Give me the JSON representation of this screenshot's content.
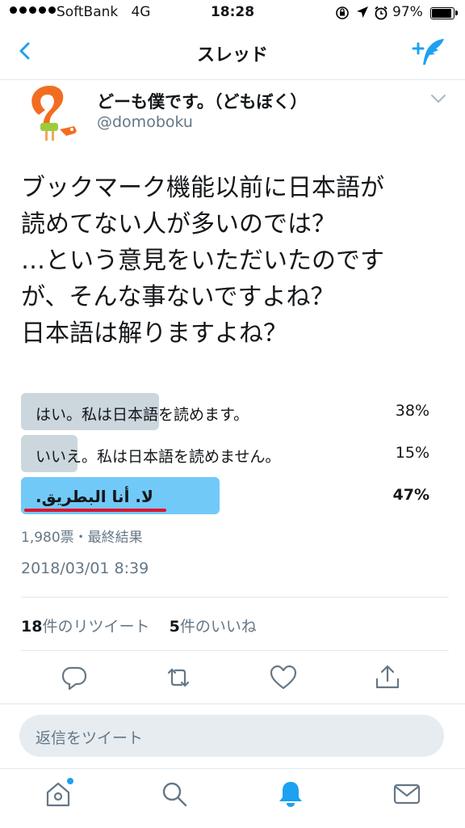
{
  "status_bar": {
    "carrier": "SoftBank",
    "network": "4G",
    "time": "18:28",
    "battery": "97%",
    "battery_level": 0.97
  },
  "nav": {
    "title": "スレッド",
    "back_icon": "chevron-left-icon",
    "compose_icon": "compose-tweet-icon"
  },
  "tweet": {
    "display_name": "どーも僕です。（どもぼく）",
    "handle": "@domoboku",
    "text_lines": [
      "ブックマーク機能以前に日本語が",
      "読めてない人が多いのでは？",
      "…という意見をいただいたのです",
      "が、そんな事ないですよね？",
      "日本語は解りますよね？"
    ],
    "poll": {
      "options": [
        {
          "label": "はい。私は日本語を読めます。",
          "percent": "38%",
          "fraction": 0.38
        },
        {
          "label": "いいえ。私は日本語を読めません。",
          "percent": "15%",
          "fraction": 0.15
        },
        {
          "label": "لا. أنا البطريق.",
          "percent": "47%",
          "fraction": 0.47
        }
      ],
      "meta": "1,980票・最終結果"
    },
    "timestamp": "2018/03/01 8:39",
    "stats": {
      "retweets_count": "18",
      "retweets_label": "件のリツイート",
      "likes_count": "5",
      "likes_label": "件のいいね"
    }
  },
  "reply": {
    "placeholder": "返信をツイート"
  },
  "colors": {
    "accent": "#1da1f2",
    "poll_bar": "#ccd6dd",
    "poll_winner": "#71c9f8",
    "underline": "#e0142c"
  }
}
